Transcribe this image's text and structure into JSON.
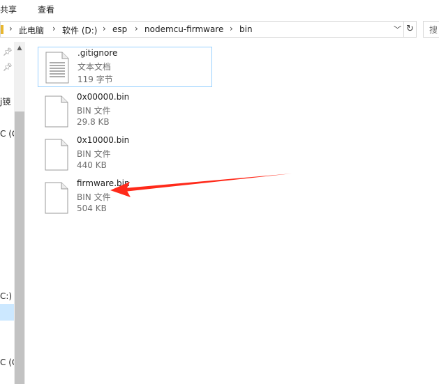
{
  "ribbon": {
    "tabs": [
      {
        "label": "共享"
      },
      {
        "label": "查看"
      }
    ]
  },
  "address_bar": {
    "crumbs": [
      {
        "label": "此电脑"
      },
      {
        "label": "软件 (D:)"
      },
      {
        "label": "esp"
      },
      {
        "label": "nodemcu-firmware"
      },
      {
        "label": "bin"
      }
    ],
    "dropdown_glyph": "﹀",
    "refresh_glyph": "↻",
    "search_text": "搜"
  },
  "nav_pane": {
    "items": [
      {
        "label": "j镜"
      },
      {
        "label": "C (G"
      },
      {
        "label": "C:)"
      },
      {
        "label": "C (G"
      }
    ]
  },
  "files": [
    {
      "name": ".gitignore",
      "type": "文本文档",
      "size": "119 字节",
      "icon": "text-document-icon"
    },
    {
      "name": "0x00000.bin",
      "type": "BIN 文件",
      "size": "29.8 KB",
      "icon": "file-icon"
    },
    {
      "name": "0x10000.bin",
      "type": "BIN 文件",
      "size": "440 KB",
      "icon": "file-icon"
    },
    {
      "name": "firmware.bin",
      "type": "BIN 文件",
      "size": "504 KB",
      "icon": "file-icon"
    }
  ],
  "colors": {
    "annotation_arrow": "#ff2a1a",
    "selection_border": "#99d1ff",
    "folder": "#e8b730"
  }
}
